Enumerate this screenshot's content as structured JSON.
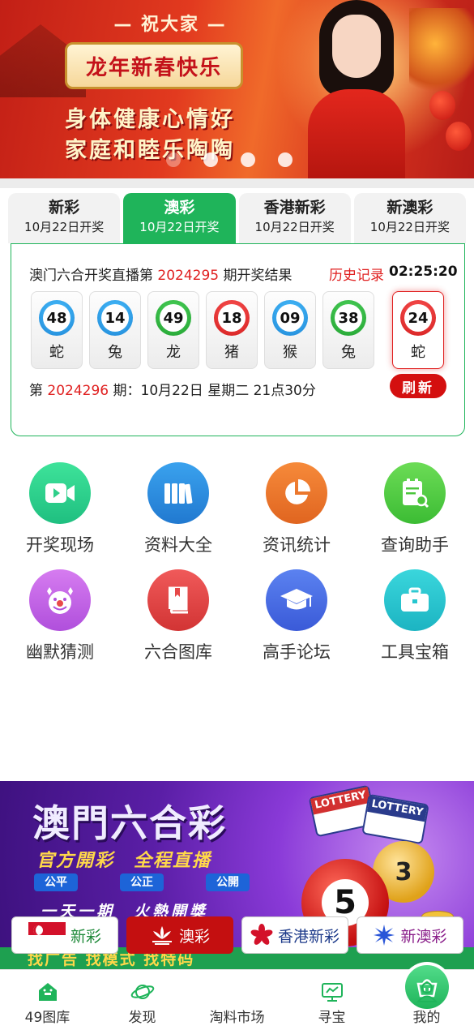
{
  "banner": {
    "greeting": "— 祝大家 —",
    "headline": "龙年新春快乐",
    "line1": "身体健康心情好",
    "line2": "家庭和睦乐陶陶",
    "slide_count": 4,
    "active_slide": 1
  },
  "tabs": [
    {
      "name": "新彩",
      "date": "10月22日开奖",
      "active": false
    },
    {
      "name": "澳彩",
      "date": "10月22日开奖",
      "active": true
    },
    {
      "name": "香港新彩",
      "date": "10月22日开奖",
      "active": false
    },
    {
      "name": "新澳彩",
      "date": "10月22日开奖",
      "active": false
    }
  ],
  "result": {
    "head_prefix": "澳门六合开奖直播第",
    "period": "2024295",
    "head_suffix": "期开奖结果",
    "history_link": "历史记录",
    "countdown": "02:25:20",
    "balls": [
      {
        "number": "48",
        "zodiac": "蛇",
        "color": "blue"
      },
      {
        "number": "14",
        "zodiac": "兔",
        "color": "blue"
      },
      {
        "number": "49",
        "zodiac": "龙",
        "color": "green"
      },
      {
        "number": "18",
        "zodiac": "猪",
        "color": "red"
      },
      {
        "number": "09",
        "zodiac": "猴",
        "color": "blue"
      },
      {
        "number": "38",
        "zodiac": "兔",
        "color": "green"
      }
    ],
    "special_ball": {
      "number": "24",
      "zodiac": "蛇",
      "color": "red"
    },
    "next_prefix": "第",
    "next_period": "2024296",
    "next_suffix": "期：10月22日 星期二 21点30分",
    "refresh_label": "刷新"
  },
  "grid": [
    {
      "label": "开奖现场",
      "icon": "video-camera-icon",
      "color": "#2fcf8a"
    },
    {
      "label": "资料大全",
      "icon": "books-icon",
      "color": "#2e8fe0"
    },
    {
      "label": "资讯统计",
      "icon": "pie-chart-icon",
      "color": "#f07a2a"
    },
    {
      "label": "查询助手",
      "icon": "search-document-icon",
      "color": "#5ccf46"
    },
    {
      "label": "幽默猜测",
      "icon": "clown-icon",
      "color": "#c866e6"
    },
    {
      "label": "六合图库",
      "icon": "album-book-icon",
      "color": "#e64848"
    },
    {
      "label": "高手论坛",
      "icon": "graduation-cap-icon",
      "color": "#4a6ee8"
    },
    {
      "label": "工具宝箱",
      "icon": "toolbox-icon",
      "color": "#26c6cf"
    }
  ],
  "ad": {
    "title": "澳門六合彩",
    "subtitle": "官方開彩　全程直播",
    "chips": [
      "公平",
      "公正",
      "公開"
    ],
    "slogan": "一天一期　火熱開獎",
    "ball_main": "5",
    "ball_second": "3",
    "ticket_label": "LOTTERY",
    "strip_text": "找广告 找模式 找特码"
  },
  "regions": [
    {
      "label": "新彩",
      "active": false
    },
    {
      "label": "澳彩",
      "active": true
    },
    {
      "label": "香港新彩",
      "active": false
    },
    {
      "label": "新澳彩",
      "active": false
    }
  ],
  "nav": [
    {
      "label": "49图库",
      "icon": "home-icon"
    },
    {
      "label": "发现",
      "icon": "planet-icon"
    },
    {
      "label": "淘料市场",
      "icon": "basket-icon"
    },
    {
      "label": "寻宝",
      "icon": "monitor-icon"
    },
    {
      "label": "我的",
      "icon": "user-icon"
    }
  ],
  "colors": {
    "accent": "#1fb45a",
    "highlight": "#e02020",
    "refresh": "#d40f0f"
  }
}
